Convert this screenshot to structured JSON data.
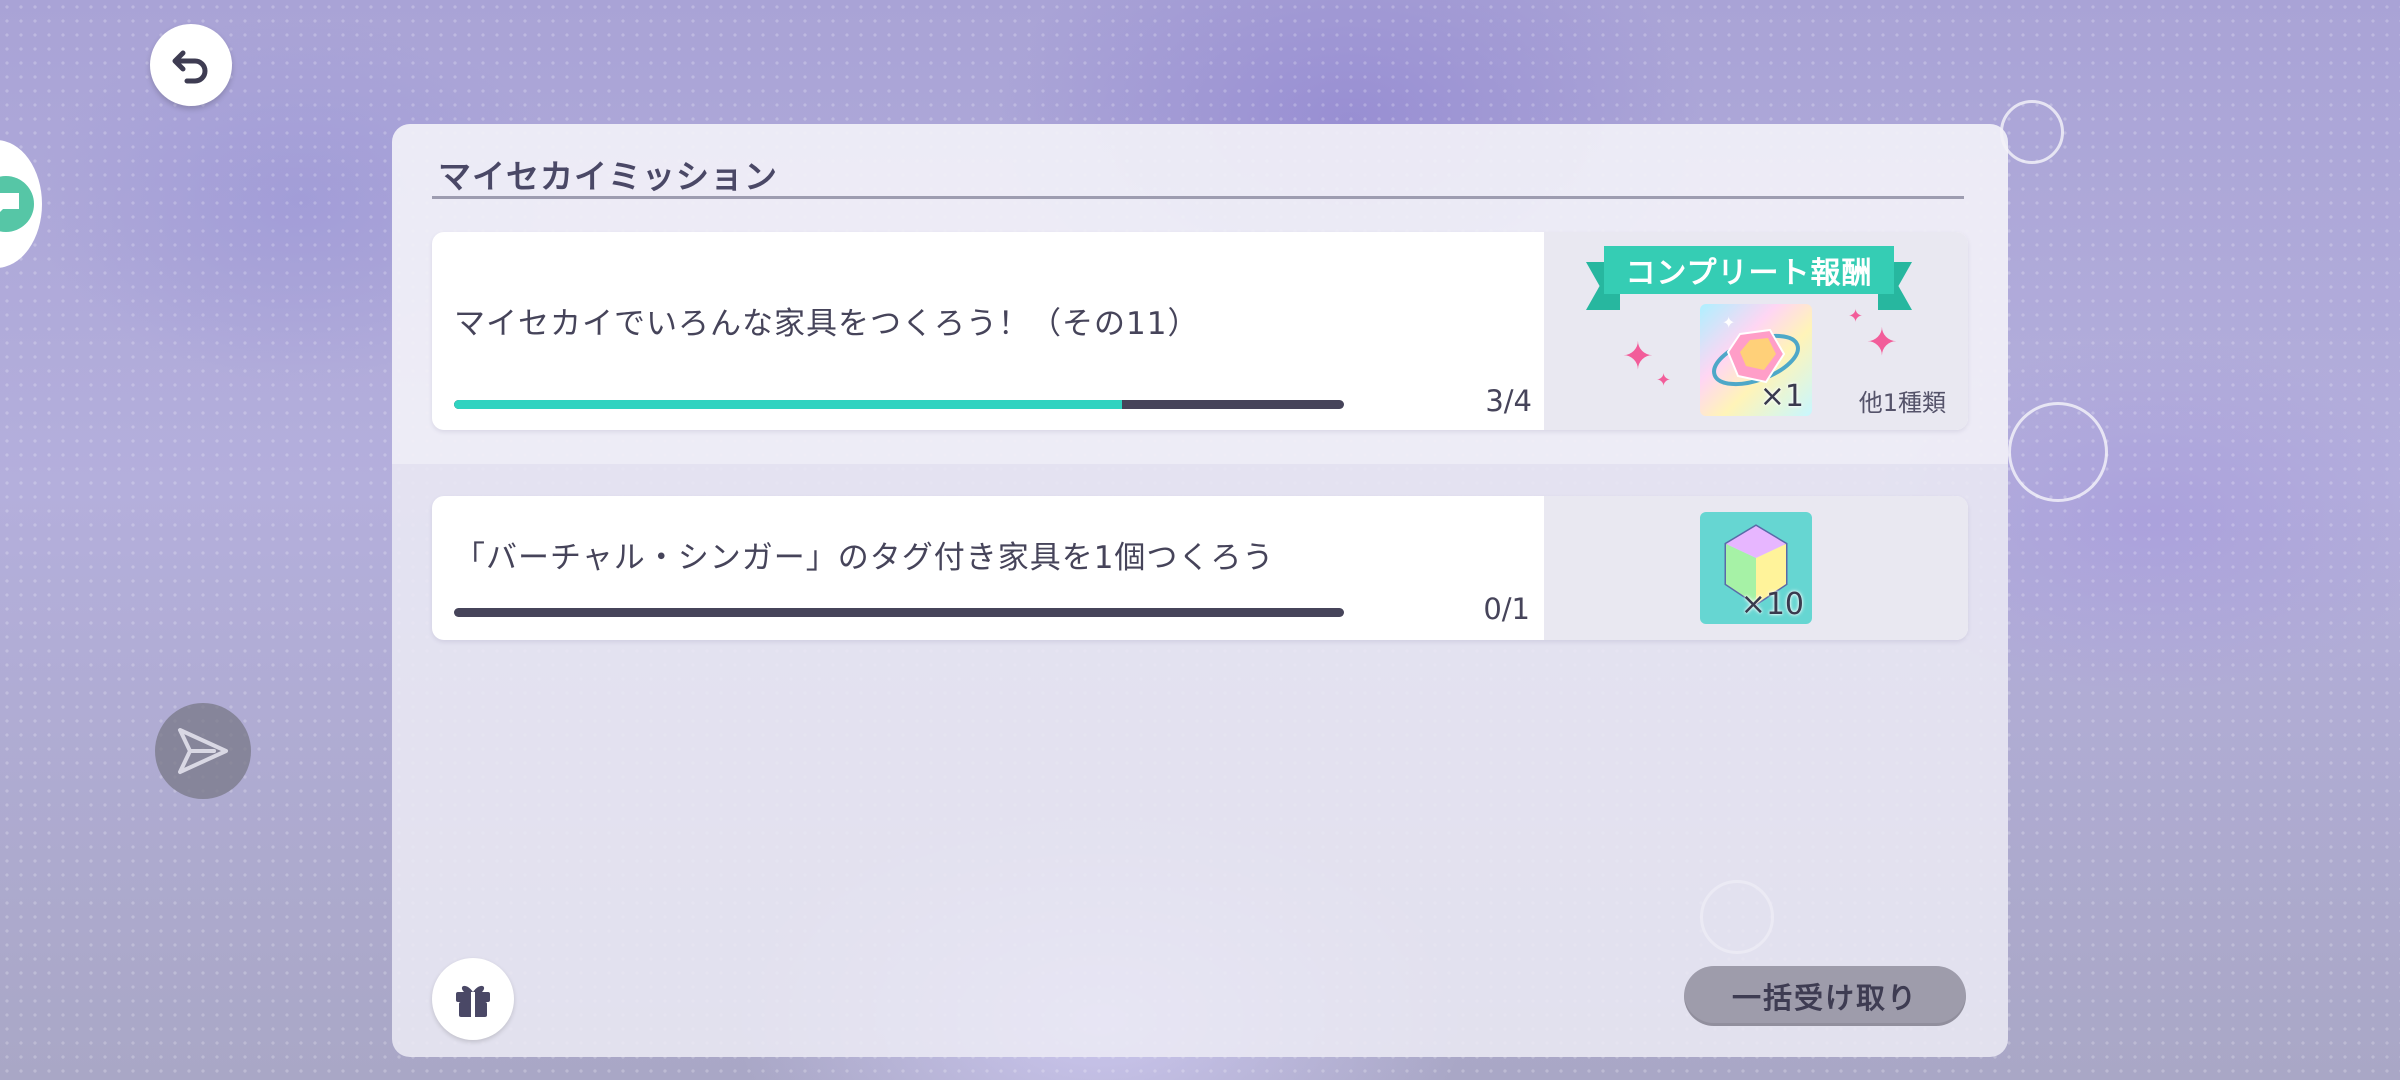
{
  "panel": {
    "title": "マイセカイミッション"
  },
  "missions": [
    {
      "text": "マイセカイでいろんな家具をつくろう！（その11）",
      "progress_count": "3/4",
      "progress_fraction": 0.75,
      "complete_reward_label": "コンプリート報酬",
      "reward_icon": "crystal-bundle-icon",
      "reward_quantity": "×1",
      "other_rewards_text": "他1種類"
    },
    {
      "text": "「バーチャル・シンガー」のタグ付き家具を1個つくろう",
      "progress_count": "0/1",
      "progress_fraction": 0,
      "reward_icon": "gem-icon",
      "reward_quantity": "×10"
    }
  ],
  "footer": {
    "claim_all_label": "一括受け取り",
    "gift_icon": "gift-icon"
  },
  "side": {
    "back_icon": "undo-arrow-icon",
    "chat_icon": "chat-bubble-icon",
    "send_icon": "send-icon"
  },
  "colors": {
    "accent_teal": "#35cdb4",
    "progress_fill": "#2fd3c0",
    "text_dark": "#46445a",
    "sparkle_pink": "#f25d9a"
  }
}
